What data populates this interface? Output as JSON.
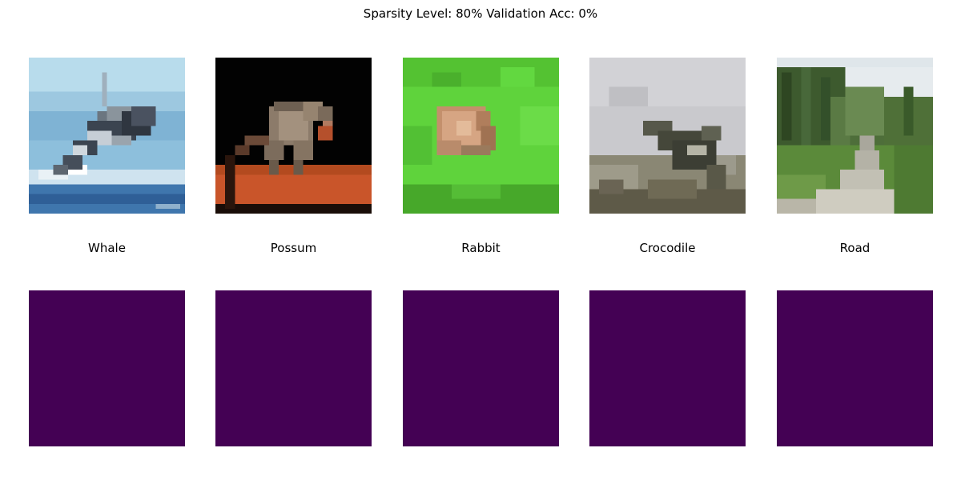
{
  "figure": {
    "title": "Sparsity Level: 80% Validation Acc: 0%"
  },
  "colors": {
    "background": "#ffffff",
    "mask_fill": "#440154",
    "text": "#000000"
  },
  "samples": [
    {
      "label": "Whale",
      "image": "whale-thumbnail",
      "mask": "attribution-mask"
    },
    {
      "label": "Possum",
      "image": "possum-thumbnail",
      "mask": "attribution-mask"
    },
    {
      "label": "Rabbit",
      "image": "rabbit-thumbnail",
      "mask": "attribution-mask"
    },
    {
      "label": "Crocodile",
      "image": "crocodile-thumbnail",
      "mask": "attribution-mask"
    },
    {
      "label": "Road",
      "image": "road-thumbnail",
      "mask": "attribution-mask"
    }
  ]
}
